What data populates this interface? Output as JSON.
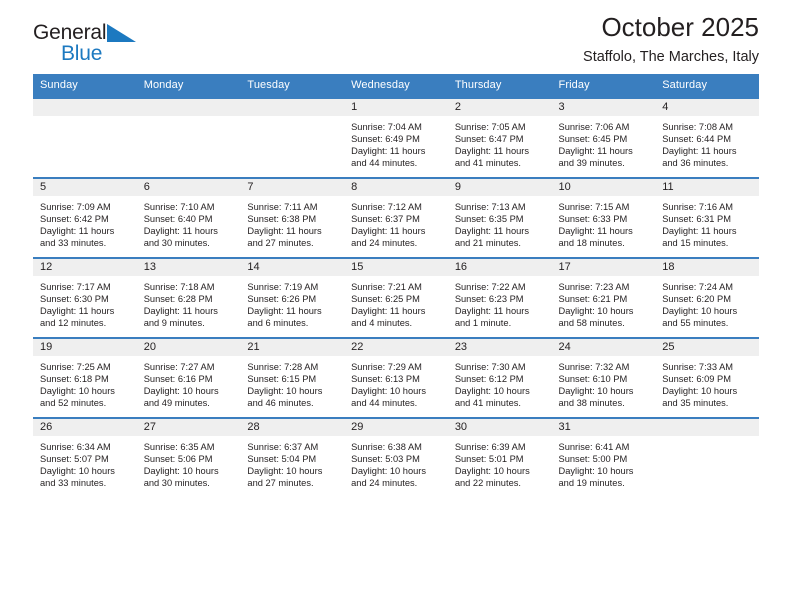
{
  "brand": {
    "name_part1": "General",
    "name_part2": "Blue",
    "triangle_icon": "triangle-logo-icon",
    "accent_color": "#1c79c0"
  },
  "header": {
    "title": "October 2025",
    "subtitle": "Staffolo, The Marches, Italy"
  },
  "theme": {
    "header_blue": "#3a7ebf",
    "day_band_gray": "#efefef",
    "text_color": "#231f20"
  },
  "weekdays": [
    "Sunday",
    "Monday",
    "Tuesday",
    "Wednesday",
    "Thursday",
    "Friday",
    "Saturday"
  ],
  "weeks": [
    [
      {
        "day": "",
        "sunrise": "",
        "sunset": "",
        "daylight": "",
        "blank": true
      },
      {
        "day": "",
        "sunrise": "",
        "sunset": "",
        "daylight": "",
        "blank": true
      },
      {
        "day": "",
        "sunrise": "",
        "sunset": "",
        "daylight": "",
        "blank": true
      },
      {
        "day": "1",
        "sunrise": "Sunrise: 7:04 AM",
        "sunset": "Sunset: 6:49 PM",
        "daylight": "Daylight: 11 hours and 44 minutes."
      },
      {
        "day": "2",
        "sunrise": "Sunrise: 7:05 AM",
        "sunset": "Sunset: 6:47 PM",
        "daylight": "Daylight: 11 hours and 41 minutes."
      },
      {
        "day": "3",
        "sunrise": "Sunrise: 7:06 AM",
        "sunset": "Sunset: 6:45 PM",
        "daylight": "Daylight: 11 hours and 39 minutes."
      },
      {
        "day": "4",
        "sunrise": "Sunrise: 7:08 AM",
        "sunset": "Sunset: 6:44 PM",
        "daylight": "Daylight: 11 hours and 36 minutes."
      }
    ],
    [
      {
        "day": "5",
        "sunrise": "Sunrise: 7:09 AM",
        "sunset": "Sunset: 6:42 PM",
        "daylight": "Daylight: 11 hours and 33 minutes."
      },
      {
        "day": "6",
        "sunrise": "Sunrise: 7:10 AM",
        "sunset": "Sunset: 6:40 PM",
        "daylight": "Daylight: 11 hours and 30 minutes."
      },
      {
        "day": "7",
        "sunrise": "Sunrise: 7:11 AM",
        "sunset": "Sunset: 6:38 PM",
        "daylight": "Daylight: 11 hours and 27 minutes."
      },
      {
        "day": "8",
        "sunrise": "Sunrise: 7:12 AM",
        "sunset": "Sunset: 6:37 PM",
        "daylight": "Daylight: 11 hours and 24 minutes."
      },
      {
        "day": "9",
        "sunrise": "Sunrise: 7:13 AM",
        "sunset": "Sunset: 6:35 PM",
        "daylight": "Daylight: 11 hours and 21 minutes."
      },
      {
        "day": "10",
        "sunrise": "Sunrise: 7:15 AM",
        "sunset": "Sunset: 6:33 PM",
        "daylight": "Daylight: 11 hours and 18 minutes."
      },
      {
        "day": "11",
        "sunrise": "Sunrise: 7:16 AM",
        "sunset": "Sunset: 6:31 PM",
        "daylight": "Daylight: 11 hours and 15 minutes."
      }
    ],
    [
      {
        "day": "12",
        "sunrise": "Sunrise: 7:17 AM",
        "sunset": "Sunset: 6:30 PM",
        "daylight": "Daylight: 11 hours and 12 minutes."
      },
      {
        "day": "13",
        "sunrise": "Sunrise: 7:18 AM",
        "sunset": "Sunset: 6:28 PM",
        "daylight": "Daylight: 11 hours and 9 minutes."
      },
      {
        "day": "14",
        "sunrise": "Sunrise: 7:19 AM",
        "sunset": "Sunset: 6:26 PM",
        "daylight": "Daylight: 11 hours and 6 minutes."
      },
      {
        "day": "15",
        "sunrise": "Sunrise: 7:21 AM",
        "sunset": "Sunset: 6:25 PM",
        "daylight": "Daylight: 11 hours and 4 minutes."
      },
      {
        "day": "16",
        "sunrise": "Sunrise: 7:22 AM",
        "sunset": "Sunset: 6:23 PM",
        "daylight": "Daylight: 11 hours and 1 minute."
      },
      {
        "day": "17",
        "sunrise": "Sunrise: 7:23 AM",
        "sunset": "Sunset: 6:21 PM",
        "daylight": "Daylight: 10 hours and 58 minutes."
      },
      {
        "day": "18",
        "sunrise": "Sunrise: 7:24 AM",
        "sunset": "Sunset: 6:20 PM",
        "daylight": "Daylight: 10 hours and 55 minutes."
      }
    ],
    [
      {
        "day": "19",
        "sunrise": "Sunrise: 7:25 AM",
        "sunset": "Sunset: 6:18 PM",
        "daylight": "Daylight: 10 hours and 52 minutes."
      },
      {
        "day": "20",
        "sunrise": "Sunrise: 7:27 AM",
        "sunset": "Sunset: 6:16 PM",
        "daylight": "Daylight: 10 hours and 49 minutes."
      },
      {
        "day": "21",
        "sunrise": "Sunrise: 7:28 AM",
        "sunset": "Sunset: 6:15 PM",
        "daylight": "Daylight: 10 hours and 46 minutes."
      },
      {
        "day": "22",
        "sunrise": "Sunrise: 7:29 AM",
        "sunset": "Sunset: 6:13 PM",
        "daylight": "Daylight: 10 hours and 44 minutes."
      },
      {
        "day": "23",
        "sunrise": "Sunrise: 7:30 AM",
        "sunset": "Sunset: 6:12 PM",
        "daylight": "Daylight: 10 hours and 41 minutes."
      },
      {
        "day": "24",
        "sunrise": "Sunrise: 7:32 AM",
        "sunset": "Sunset: 6:10 PM",
        "daylight": "Daylight: 10 hours and 38 minutes."
      },
      {
        "day": "25",
        "sunrise": "Sunrise: 7:33 AM",
        "sunset": "Sunset: 6:09 PM",
        "daylight": "Daylight: 10 hours and 35 minutes."
      }
    ],
    [
      {
        "day": "26",
        "sunrise": "Sunrise: 6:34 AM",
        "sunset": "Sunset: 5:07 PM",
        "daylight": "Daylight: 10 hours and 33 minutes."
      },
      {
        "day": "27",
        "sunrise": "Sunrise: 6:35 AM",
        "sunset": "Sunset: 5:06 PM",
        "daylight": "Daylight: 10 hours and 30 minutes."
      },
      {
        "day": "28",
        "sunrise": "Sunrise: 6:37 AM",
        "sunset": "Sunset: 5:04 PM",
        "daylight": "Daylight: 10 hours and 27 minutes."
      },
      {
        "day": "29",
        "sunrise": "Sunrise: 6:38 AM",
        "sunset": "Sunset: 5:03 PM",
        "daylight": "Daylight: 10 hours and 24 minutes."
      },
      {
        "day": "30",
        "sunrise": "Sunrise: 6:39 AM",
        "sunset": "Sunset: 5:01 PM",
        "daylight": "Daylight: 10 hours and 22 minutes."
      },
      {
        "day": "31",
        "sunrise": "Sunrise: 6:41 AM",
        "sunset": "Sunset: 5:00 PM",
        "daylight": "Daylight: 10 hours and 19 minutes."
      },
      {
        "day": "",
        "sunrise": "",
        "sunset": "",
        "daylight": "",
        "blank": true
      }
    ]
  ]
}
